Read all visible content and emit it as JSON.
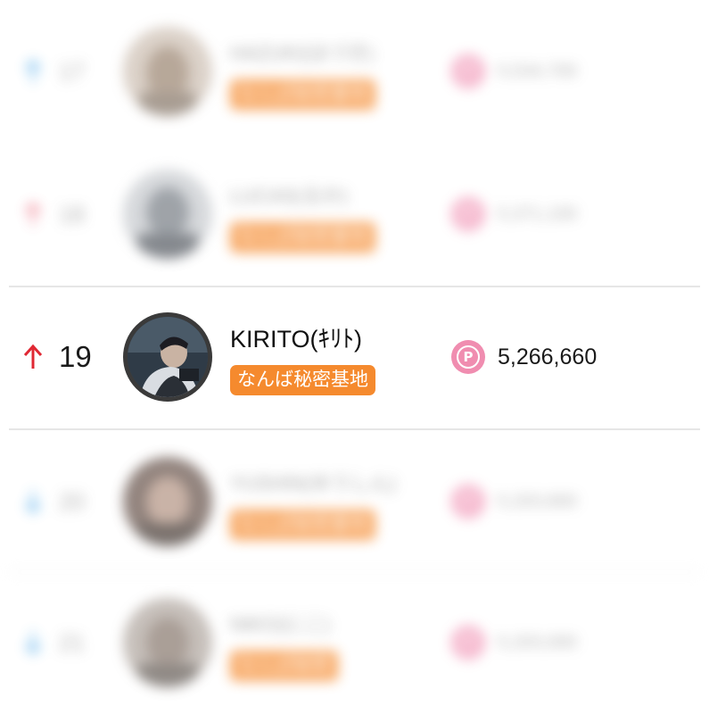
{
  "ranking": [
    {
      "trend": "up",
      "trend_color": "#3aa0e6",
      "rank": "17",
      "name": "HAZUKI(はづき)",
      "tag": "なんば秘密基地",
      "points": "5,534,700",
      "blurred": true
    },
    {
      "trend": "up",
      "trend_color": "#ea5a6e",
      "rank": "18",
      "name": "LUCAS(るか)",
      "tag": "なんば秘密基地",
      "points": "5,371,100",
      "blurred": true
    },
    {
      "trend": "up",
      "trend_color": "#e02833",
      "rank": "19",
      "name": "KIRITO(ｷﾘﾄ)",
      "tag": "なんば秘密基地",
      "points": "5,266,660",
      "blurred": false
    },
    {
      "trend": "down",
      "trend_color": "#3aa0e6",
      "rank": "20",
      "name": "YUSHIN(ゆうしん)",
      "tag": "なんば秘密基地",
      "points": "5,203,800",
      "blurred": true
    },
    {
      "trend": "down",
      "trend_color": "#3aa0e6",
      "rank": "21",
      "name": "NIKO(にこ)",
      "tag": "なんば秘密",
      "points": "5,203,000",
      "blurred": true
    }
  ],
  "point_icon_label": "P",
  "colors": {
    "tag_bg": "#f58a2e",
    "point_icon": "#f08db0",
    "up_arrow": "#e02833"
  },
  "icons": {
    "trend_up": "arrow-up-icon",
    "trend_down": "arrow-down-icon",
    "points": "point-p-icon"
  }
}
